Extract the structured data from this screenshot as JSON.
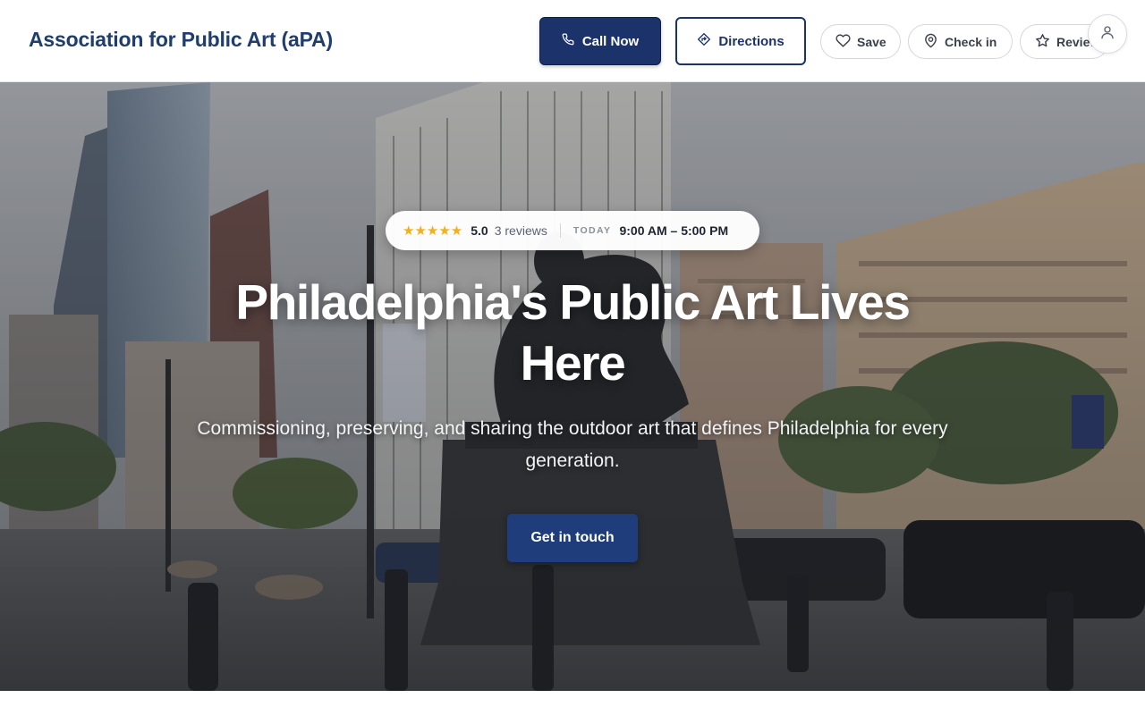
{
  "header": {
    "brand": "Association for Public Art (aPA)",
    "call_label": "Call Now",
    "directions_label": "Directions",
    "save_label": "Save",
    "checkin_label": "Check in",
    "review_label": "Review"
  },
  "hero": {
    "rating": {
      "stars": "★★★★★",
      "score": "5.0",
      "reviews": "3 reviews",
      "today_label": "TODAY",
      "hours": "9:00 AM – 5:00 PM"
    },
    "title": "Philadelphia's Public Art Lives Here",
    "subtitle": "Commissioning, preserving, and sharing the outdoor art that defines Philadelphia for every generation.",
    "cta_label": "Get in touch"
  },
  "colors": {
    "brand": "#1f3d6e",
    "primary_button": "#1c326b",
    "star": "#f2b01e"
  },
  "icons": [
    "phone-icon",
    "directions-icon",
    "heart-icon",
    "map-pin-icon",
    "star-icon",
    "user-icon"
  ]
}
